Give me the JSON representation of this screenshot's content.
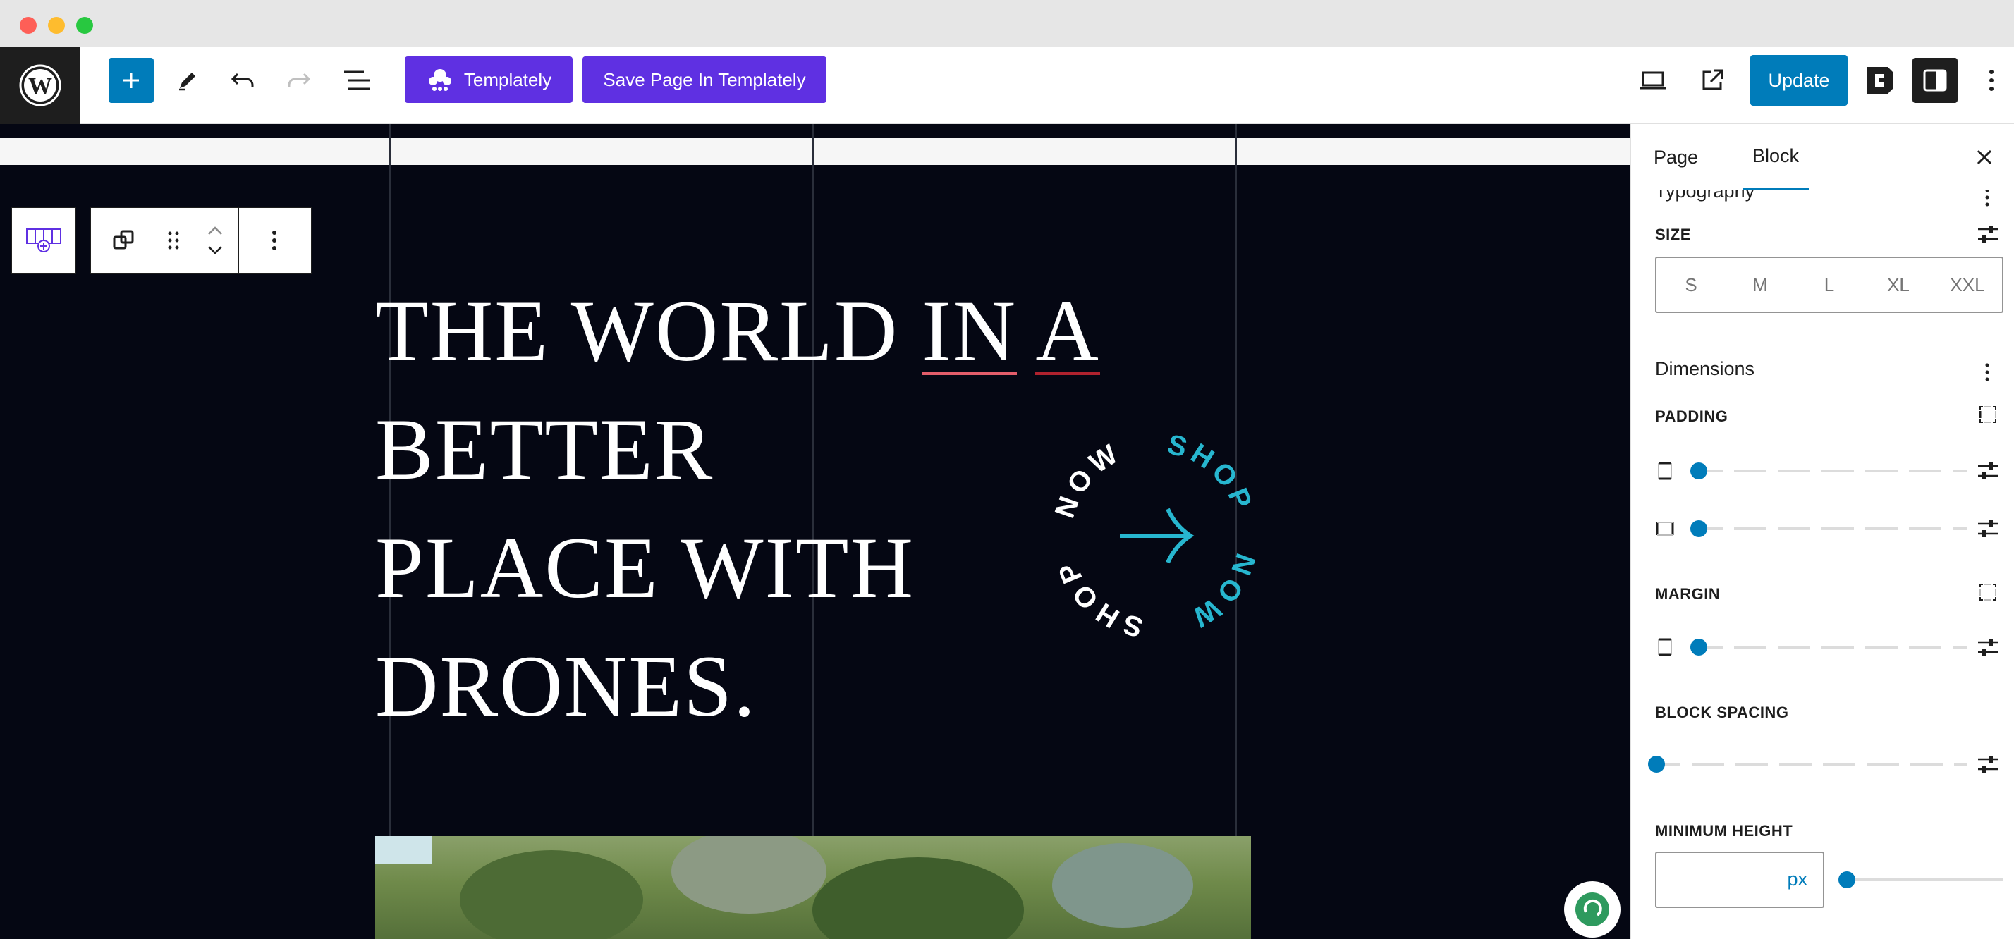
{
  "toolbar": {
    "templately_label": "Templately",
    "save_templately_label": "Save Page In Templately",
    "update_label": "Update"
  },
  "canvas": {
    "headline": [
      "THE WORLD IN A",
      "BETTER",
      "PLACE WITH",
      "DRONES."
    ],
    "headline_underlined": [
      "IN",
      "A"
    ],
    "badge_text_top": "SHOP",
    "badge_text_left": "NOW",
    "badge_text_bottom": "SHOP",
    "badge_text_right": "NOW"
  },
  "sidebar": {
    "tabs": [
      {
        "label": "Page",
        "active": false
      },
      {
        "label": "Block",
        "active": true
      }
    ],
    "typography": {
      "title": "Typography",
      "size_caption": "SIZE",
      "size_options": [
        "S",
        "M",
        "L",
        "XL",
        "XXL"
      ]
    },
    "dimensions": {
      "title": "Dimensions",
      "padding_caption": "PADDING",
      "margin_caption": "MARGIN",
      "block_spacing_caption": "BLOCK SPACING",
      "min_height_caption": "MINIMUM HEIGHT",
      "min_height_value": "",
      "min_height_unit": "px",
      "padding_vertical": 0,
      "padding_horizontal": 0,
      "margin_vertical": 0,
      "block_spacing": 0,
      "min_height": 0
    }
  },
  "colors": {
    "accent": "#007cba",
    "templately": "#5f30e2",
    "canvas_bg": "#050713",
    "badge_cyan": "#27b6cf"
  }
}
